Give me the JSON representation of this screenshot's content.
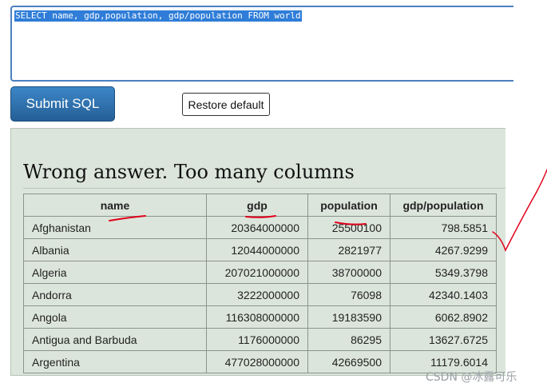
{
  "editor": {
    "sql": "SELECT name, gdp,population, gdp/population FROM world"
  },
  "buttons": {
    "submit": "Submit SQL",
    "restore": "Restore default"
  },
  "result": {
    "message": "Wrong answer. Too many columns",
    "columns": [
      "name",
      "gdp",
      "population",
      "gdp/population"
    ],
    "rows": [
      [
        "Afghanistan",
        "20364000000",
        "25500100",
        "798.5851"
      ],
      [
        "Albania",
        "12044000000",
        "2821977",
        "4267.9299"
      ],
      [
        "Algeria",
        "207021000000",
        "38700000",
        "5349.3798"
      ],
      [
        "Andorra",
        "3222000000",
        "76098",
        "42340.1403"
      ],
      [
        "Angola",
        "116308000000",
        "19183590",
        "6062.8902"
      ],
      [
        "Antigua and Barbuda",
        "1176000000",
        "86295",
        "13627.6725"
      ],
      [
        "Argentina",
        "477028000000",
        "42669500",
        "11179.6014"
      ]
    ]
  },
  "watermark": "CSDN @冰露可乐",
  "colors": {
    "submit_bg": "#2f6fa8",
    "selection": "#2f7dd8",
    "panel_bg": "#dce5dc",
    "annotation": "#e0001a"
  }
}
